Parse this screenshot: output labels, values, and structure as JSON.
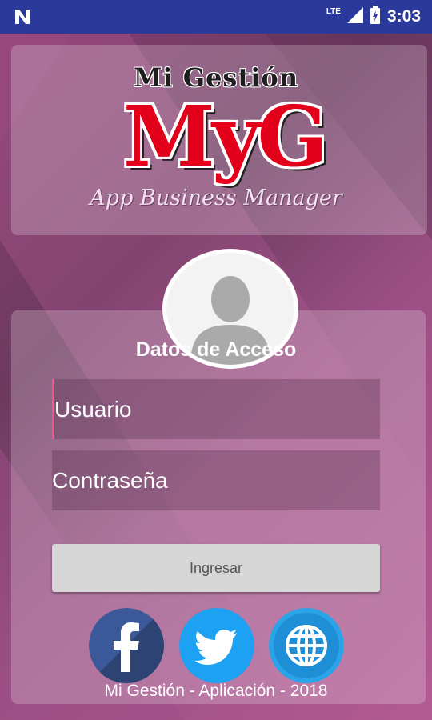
{
  "status_bar": {
    "network": "LTE",
    "time": "3:03"
  },
  "brand": {
    "title": "Mi Gestión",
    "logo_letters": "MyG",
    "subtitle": "App Business Manager"
  },
  "login": {
    "title": "Datos de Acceso",
    "username_placeholder": "Usuario",
    "password_placeholder": "Contraseña",
    "submit_label": "Ingresar"
  },
  "social": [
    {
      "name": "facebook",
      "icon": "facebook-icon",
      "color": "#3b5998"
    },
    {
      "name": "twitter",
      "icon": "twitter-icon",
      "color": "#1da1f2"
    },
    {
      "name": "website",
      "icon": "globe-icon",
      "color": "#29a3e8"
    }
  ],
  "footer": "Mi Gestión - Aplicación - 2018",
  "colors": {
    "status_bar": "#2b3a9a",
    "brand_red": "#e3001b",
    "background": "#7a3d68"
  }
}
